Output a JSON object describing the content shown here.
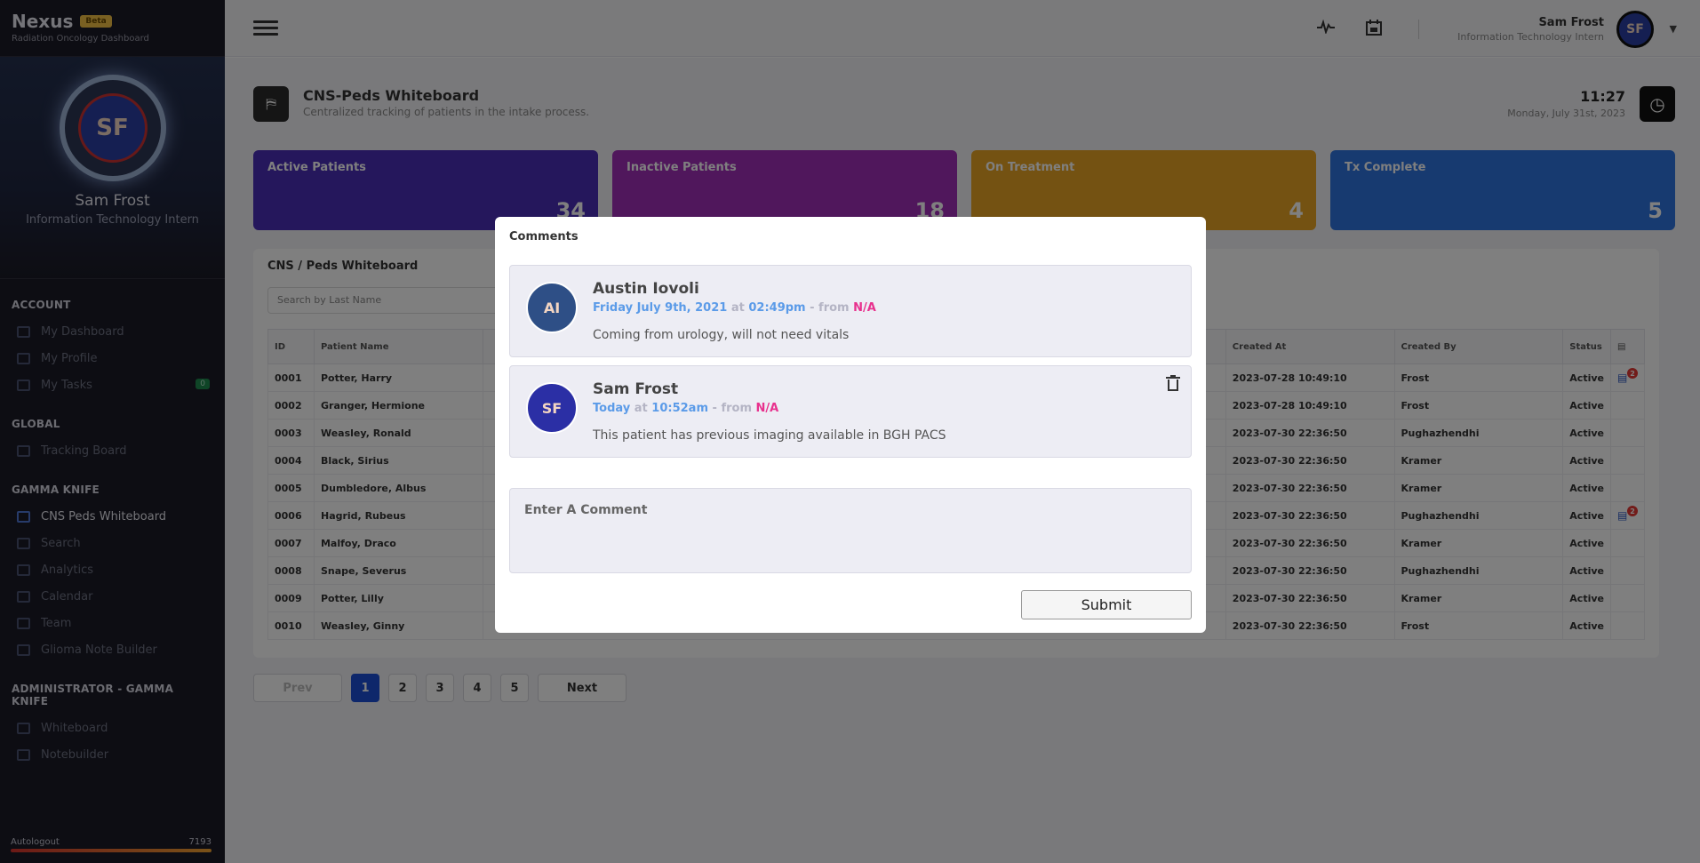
{
  "app": {
    "brand": "Nexus",
    "badge": "Beta",
    "subtitle": "Radiation Oncology Dashboard"
  },
  "sidebar": {
    "profile": {
      "name": "Sam Frost",
      "role": "Information Technology Intern",
      "initials": "SF"
    },
    "sections": [
      {
        "title": "ACCOUNT",
        "items": [
          {
            "label": "My Dashboard",
            "icon": "dashboard-icon"
          },
          {
            "label": "My Profile",
            "icon": "user-icon"
          },
          {
            "label": "My Tasks",
            "icon": "tasks-icon",
            "badge": "0"
          }
        ]
      },
      {
        "title": "GLOBAL",
        "items": [
          {
            "label": "Tracking Board",
            "icon": "board-icon"
          }
        ]
      },
      {
        "title": "GAMMA KNIFE",
        "items": [
          {
            "label": "CNS Peds Whiteboard",
            "icon": "whiteboard-icon",
            "active": true
          },
          {
            "label": "Search",
            "icon": "search-icon"
          },
          {
            "label": "Analytics",
            "icon": "analytics-icon"
          },
          {
            "label": "Calendar",
            "icon": "calendar-icon"
          },
          {
            "label": "Team",
            "icon": "team-icon"
          },
          {
            "label": "Glioma Note Builder",
            "icon": "note-icon"
          }
        ]
      },
      {
        "title": "ADMINISTRATOR - GAMMA KNIFE",
        "items": [
          {
            "label": "Whiteboard",
            "icon": "shield-icon"
          },
          {
            "label": "Notebuilder",
            "icon": "note-icon"
          }
        ]
      }
    ],
    "autologout": {
      "label": "Autologout",
      "value": "7193"
    }
  },
  "topbar": {
    "user_name": "Sam Frost",
    "user_role": "Information Technology Intern",
    "avatar_initials": "SF"
  },
  "page": {
    "title": "CNS-Peds Whiteboard",
    "subtitle": "Centralized tracking of patients in the intake process.",
    "time": "11:27",
    "date": "Monday, July 31st, 2023"
  },
  "stats": [
    {
      "label": "Active Patients",
      "value": "34",
      "color": "#4b2fb8"
    },
    {
      "label": "Inactive Patients",
      "value": "18",
      "color": "#a12fb8"
    },
    {
      "label": "On Treatment",
      "value": "4",
      "color": "#e8a524"
    },
    {
      "label": "Tx Complete",
      "value": "5",
      "color": "#2e74e0"
    }
  ],
  "table": {
    "title": "CNS / Peds Whiteboard",
    "search_placeholder": "Search by Last Name",
    "headers": [
      "ID",
      "Patient Name",
      "Created At",
      "Created By",
      "Status"
    ],
    "rows": [
      {
        "id": "0001",
        "name": "Potter, Harry",
        "created_at": "2023-07-28 10:49:10",
        "created_by": "Frost",
        "status": "Active",
        "comments": "2"
      },
      {
        "id": "0002",
        "name": "Granger, Hermione",
        "created_at": "2023-07-28 10:49:10",
        "created_by": "Frost",
        "status": "Active",
        "comments": ""
      },
      {
        "id": "0003",
        "name": "Weasley, Ronald",
        "created_at": "2023-07-30 22:36:50",
        "created_by": "Pughazhendhi",
        "status": "Active",
        "comments": ""
      },
      {
        "id": "0004",
        "name": "Black, Sirius",
        "created_at": "2023-07-30 22:36:50",
        "created_by": "Kramer",
        "status": "Active",
        "comments": ""
      },
      {
        "id": "0005",
        "name": "Dumbledore, Albus",
        "created_at": "2023-07-30 22:36:50",
        "created_by": "Kramer",
        "status": "Active",
        "comments": ""
      },
      {
        "id": "0006",
        "name": "Hagrid, Rubeus",
        "created_at": "2023-07-30 22:36:50",
        "created_by": "Pughazhendhi",
        "status": "Active",
        "comments": "2"
      },
      {
        "id": "0007",
        "name": "Malfoy, Draco",
        "created_at": "2023-07-30 22:36:50",
        "created_by": "Kramer",
        "status": "Active",
        "comments": ""
      },
      {
        "id": "0008",
        "name": "Snape, Severus",
        "created_at": "2023-07-30 22:36:50",
        "created_by": "Pughazhendhi",
        "status": "Active",
        "comments": ""
      },
      {
        "id": "0009",
        "name": "Potter, Lilly",
        "created_at": "2023-07-30 22:36:50",
        "created_by": "Kramer",
        "status": "Active",
        "comments": ""
      },
      {
        "id": "0010",
        "name": "Weasley, Ginny",
        "created_at": "2023-07-30 22:36:50",
        "created_by": "Frost",
        "status": "Active",
        "comments": ""
      }
    ]
  },
  "pagination": {
    "prev": "Prev",
    "next": "Next",
    "pages": [
      "1",
      "2",
      "3",
      "4",
      "5"
    ],
    "current": "1"
  },
  "modal": {
    "title": "Comments",
    "comments": [
      {
        "author": "Austin Iovoli",
        "initials": "AI",
        "avatar_color": "#2e4f86",
        "date": "Friday July 9th, 2021",
        "at": "at",
        "time": "02:49pm",
        "from_label": "- from",
        "source": "N/A",
        "text": "Coming from urology, will not need vitals",
        "deletable": false
      },
      {
        "author": "Sam Frost",
        "initials": "SF",
        "avatar_color": "#2b2fa5",
        "date": "Today",
        "at": "at",
        "time": "10:52am",
        "from_label": "- from",
        "source": "N/A",
        "text": "This patient has previous imaging available in BGH PACS",
        "deletable": true
      }
    ],
    "input_placeholder": "Enter A Comment",
    "submit_label": "Submit"
  }
}
